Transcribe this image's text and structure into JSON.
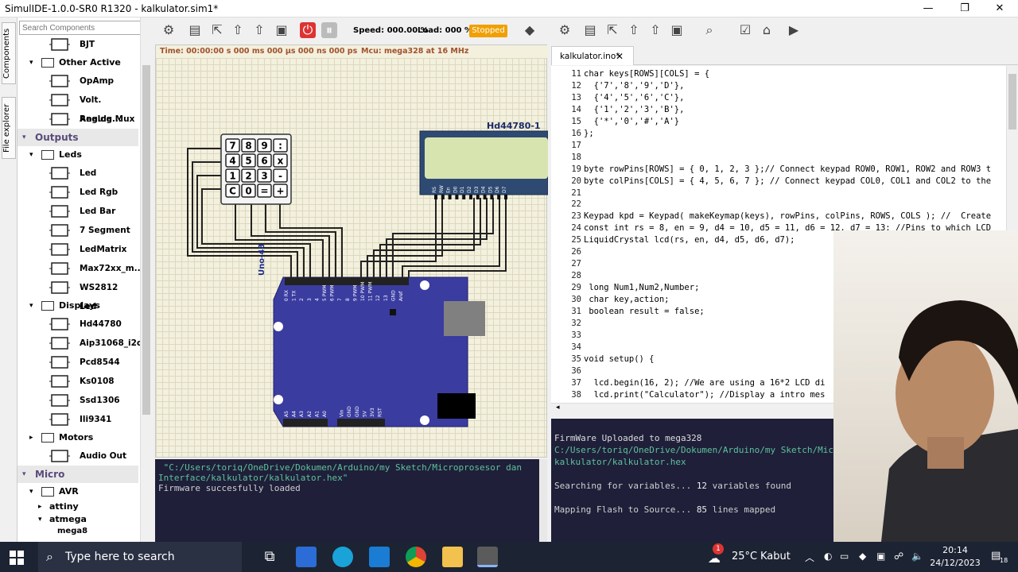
{
  "window": {
    "title": "SimulIDE-1.0.0-SR0 R1320 - kalkulator.sim1*",
    "minimize": "—",
    "maximize": "❐",
    "close": "✕"
  },
  "side_tabs": [
    "Components",
    "File explorer"
  ],
  "components": {
    "search_placeholder": "Search Components",
    "items": [
      {
        "label": "BJT",
        "icon": "bjt-icon"
      },
      {
        "group": "Other Active"
      },
      {
        "label": "OpAmp",
        "icon": "opamp-icon"
      },
      {
        "label": "Volt. Regula...",
        "icon": "regulator-icon"
      },
      {
        "label": "Analog Mux",
        "icon": "mux-icon"
      },
      {
        "category": "Outputs"
      },
      {
        "group": "Leds"
      },
      {
        "label": "Led",
        "icon": "led-icon"
      },
      {
        "label": "Led Rgb",
        "icon": "led-rgb-icon"
      },
      {
        "label": "Led Bar",
        "icon": "led-bar-icon"
      },
      {
        "label": "7 Segment",
        "icon": "seven-segment-icon"
      },
      {
        "label": "LedMatrix",
        "icon": "led-matrix-icon"
      },
      {
        "label": "Max72xx_m...",
        "icon": "max72xx-icon"
      },
      {
        "label": "WS2812 Led",
        "icon": "ws2812-icon"
      },
      {
        "group": "Displays"
      },
      {
        "label": "Hd44780",
        "icon": "lcd-icon"
      },
      {
        "label": "Aip31068_i2c",
        "icon": "lcd-i2c-icon"
      },
      {
        "label": "Pcd8544",
        "icon": "pcd-icon"
      },
      {
        "label": "Ks0108",
        "icon": "ks0108-icon"
      },
      {
        "label": "Ssd1306",
        "icon": "oled-icon"
      },
      {
        "label": "Ili9341",
        "icon": "tft-icon"
      },
      {
        "group": "Motors"
      },
      {
        "label": "Audio Out",
        "icon": "speaker-icon"
      },
      {
        "category": "Micro"
      },
      {
        "group": "AVR"
      },
      {
        "subgroup": "attiny"
      },
      {
        "subgroup": "atmega"
      },
      {
        "leaf": "mega8"
      }
    ]
  },
  "toolbar": {
    "speed": "Speed: 000.00 %",
    "load": "Load: 000 %",
    "status": "Stopped"
  },
  "circuit": {
    "time": "Time: 00:00:00 s  000 ms  000 µs  000 ns  000 ps",
    "mcu": "Mcu: mega328 at 16 MHz",
    "lcd_label": "Hd44780-1",
    "board_label": "Uno-48",
    "keypad": [
      [
        "7",
        "8",
        "9",
        ":"
      ],
      [
        "4",
        "5",
        "6",
        "x"
      ],
      [
        "1",
        "2",
        "3",
        "-"
      ],
      [
        "C",
        "0",
        "=",
        "+"
      ]
    ],
    "lcd_pins": [
      "RS",
      "RW",
      "En",
      "D0",
      "D1",
      "D2",
      "D3",
      "D4",
      "D5",
      "D6",
      "D7"
    ],
    "digital_pins": [
      "0 RX",
      "1 TX",
      "2",
      "3",
      "4",
      "5 PWM",
      "6 PWM",
      "7",
      "8",
      "9 PWM",
      "10 PWM",
      "11 PWM",
      "12",
      "13",
      "GND",
      "Aref"
    ],
    "analog_pins": [
      "A5",
      "A4",
      "A3",
      "A2",
      "A1",
      "A0",
      "Vin",
      "GND",
      "GND",
      "5V",
      "3V3",
      "RST"
    ],
    "colors": {
      "board": "#3a3ca0",
      "lcd": "#2e4a72",
      "lcd_screen": "#d8e4b0"
    }
  },
  "sim_console": [
    " \"C:/Users/toriq/OneDrive/Dokumen/Arduino/my Sketch/Microprosesor dan",
    "Interface/kalkulator/kalkulator.hex\"",
    "",
    "Firmware succesfully loaded"
  ],
  "editor": {
    "tab": "kalkulator.ino*",
    "tab_close": "✕",
    "lines": [
      {
        "n": "11",
        "t": "char keys[ROWS][COLS] = {"
      },
      {
        "n": "12",
        "t": "  {'7','8','9','D'},"
      },
      {
        "n": "13",
        "t": "  {'4','5','6','C'},"
      },
      {
        "n": "14",
        "t": "  {'1','2','3','B'},"
      },
      {
        "n": "15",
        "t": "  {'*','0','#','A'}"
      },
      {
        "n": "16",
        "t": "};"
      },
      {
        "n": "17",
        "t": ""
      },
      {
        "n": "18",
        "t": ""
      },
      {
        "n": "19",
        "t": "byte rowPins[ROWS] = { 0, 1, 2, 3 };// Connect keypad ROW0, ROW1, ROW2 and ROW3 t"
      },
      {
        "n": "20",
        "t": "byte colPins[COLS] = { 4, 5, 6, 7 }; // Connect keypad COL0, COL1 and COL2 to the"
      },
      {
        "n": "21",
        "t": ""
      },
      {
        "n": "22",
        "t": ""
      },
      {
        "n": "23",
        "t": "Keypad kpd = Keypad( makeKeymap(keys), rowPins, colPins, ROWS, COLS ); //  Create"
      },
      {
        "n": "24",
        "t": "const int rs = 8, en = 9, d4 = 10, d5 = 11, d6 = 12, d7 = 13; //Pins to which LCD"
      },
      {
        "n": "25",
        "t": "LiquidCrystal lcd(rs, en, d4, d5, d6, d7);"
      },
      {
        "n": "26",
        "t": ""
      },
      {
        "n": "27",
        "t": ""
      },
      {
        "n": "28",
        "t": ""
      },
      {
        "n": "29",
        "t": " long Num1,Num2,Number;"
      },
      {
        "n": "30",
        "t": " char key,action;"
      },
      {
        "n": "31",
        "t": " boolean result = false;"
      },
      {
        "n": "32",
        "t": ""
      },
      {
        "n": "33",
        "t": ""
      },
      {
        "n": "34",
        "t": ""
      },
      {
        "n": "35",
        "t": "void setup() {"
      },
      {
        "n": "36",
        "t": ""
      },
      {
        "n": "37",
        "t": "  lcd.begin(16, 2); //We are using a 16*2 LCD di"
      },
      {
        "n": "38",
        "t": "  lcd.print(\"Calculator\"); //Display a intro mes"
      }
    ]
  },
  "editor_console": {
    "line1": "FirmWare Uploaded to mega328",
    "line2": "C:/Users/toriq/OneDrive/Dokumen/Arduino/my Sketch/Micr",
    "line3": "kalkulator/kalkulator.hex",
    "search_pre": "Searching for variables... ",
    "search_num": "12",
    "search_post": " variables found",
    "map_pre": "Mapping Flash to Source... ",
    "map_num": "85",
    "map_post": " lines mapped"
  },
  "taskbar": {
    "search": "Type here to search",
    "temperature": "25°C",
    "weather": "Kabut",
    "time": "20:14",
    "date": "24/12/2023",
    "notifications": "18",
    "mail_badge": "1"
  }
}
